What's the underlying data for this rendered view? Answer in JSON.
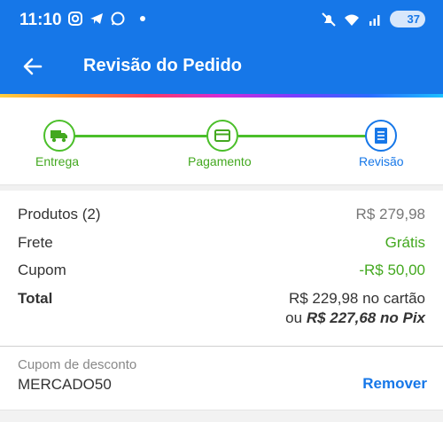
{
  "status_bar": {
    "time": "11:10",
    "battery": "37",
    "icons": [
      "instagram-icon",
      "telegram-icon",
      "whatsapp-icon",
      "mute-icon",
      "wifi-icon",
      "signal-icon"
    ]
  },
  "header": {
    "title": "Revisão do Pedido",
    "bg_color": "#1677e8"
  },
  "steps": [
    {
      "label": "Entrega",
      "icon": "truck-icon",
      "state": "done"
    },
    {
      "label": "Pagamento",
      "icon": "card-icon",
      "state": "done"
    },
    {
      "label": "Revisão",
      "icon": "receipt-icon",
      "state": "current"
    }
  ],
  "summary": {
    "products_label": "Produtos (2)",
    "products_value": "R$ 279,98",
    "shipping_label": "Frete",
    "shipping_value": "Grátis",
    "coupon_label": "Cupom",
    "coupon_value": "-R$ 50,00",
    "total_label": "Total",
    "total_card_amount": "R$ 229,98",
    "total_card_suffix": " no cartão",
    "total_pix_prefix": "ou ",
    "total_pix_amount": "R$ 227,68 no Pix"
  },
  "coupon": {
    "label": "Cupom de desconto",
    "code": "MERCADO50",
    "remove_label": "Remover"
  },
  "colors": {
    "primary": "#1677e8",
    "success": "#43a81f"
  }
}
